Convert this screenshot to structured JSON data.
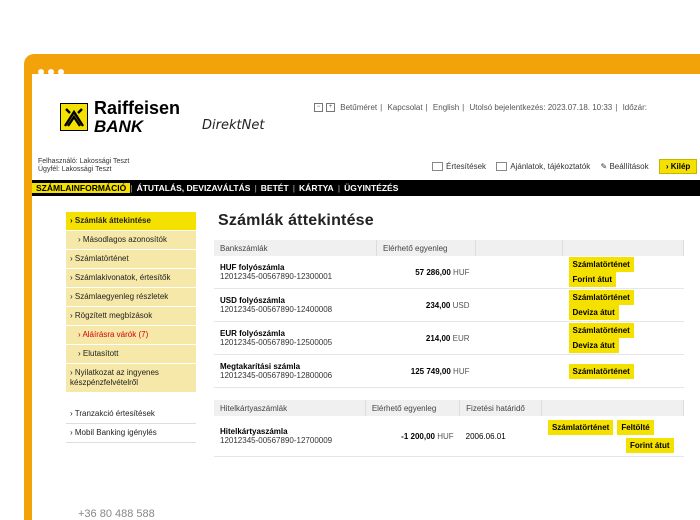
{
  "brand": {
    "name": "Raiffeisen",
    "sub": "BANK",
    "product": "DirektNet",
    "yellow": "#f5e100",
    "frame": "#f3a20a"
  },
  "toplinks": [
    "Betűméret",
    "Kapcsolat",
    "English",
    "Utolsó bejelentkezés: 2023.07.18. 10:33",
    "Időzár:"
  ],
  "user": {
    "line1": "Felhasználó: Lakossági Teszt",
    "line2": "Ügyfél: Lakossági Teszt"
  },
  "util": {
    "notifications": "Értesítések",
    "offers": "Ajánlatok, tájékoztatók",
    "settings": "Beállítások",
    "logout": "› Kilép"
  },
  "menu": [
    "SZÁMLAINFORMÁCIÓ",
    "ÁTUTALÁS, DEVIZAVÁLTÁS",
    "BETÉT",
    "KÁRTYA",
    "ÜGYINTÉZÉS"
  ],
  "sidebar": [
    "› Számlák áttekintése",
    "› Másodlagos azonosítók",
    "› Számlatörténet",
    "› Számlakivonatok, értesítők",
    "› Számlaegyenleg részletek",
    "› Rögzített megbízások",
    "› Aláírásra várók (7)",
    "› Elutasított",
    "› Nyilatkozat az ingyenes készpénzfelvételről",
    "› Tranzakció értesítések",
    "› Mobil Banking igénylés"
  ],
  "phone": "+36 80 488 588",
  "main": {
    "title": "Számlák áttekintése",
    "bank_headers": [
      "Bankszámlák",
      "Elérhető egyenleg",
      ""
    ],
    "accounts": [
      {
        "name": "HUF folyószámla",
        "number": "12012345-00567890-12300001",
        "amount": "57 286,00",
        "currency": "HUF",
        "b1": "Számlatörténet",
        "b2": "Forint átut"
      },
      {
        "name": "USD folyószámla",
        "number": "12012345-00567890-12400008",
        "amount": "234,00",
        "currency": "USD",
        "b1": "Számlatörténet",
        "b2": "Deviza átut"
      },
      {
        "name": "EUR folyószámla",
        "number": "12012345-00567890-12500005",
        "amount": "214,00",
        "currency": "EUR",
        "b1": "Számlatörténet",
        "b2": "Deviza átut"
      },
      {
        "name": "Megtakarítási számla",
        "number": "12012345-00567890-12800006",
        "amount": "125 749,00",
        "currency": "HUF",
        "b1": "Számlatörténet",
        "b2": ""
      }
    ],
    "card_headers": [
      "Hitelkártyaszámlák",
      "Elérhető egyenleg",
      "Fizetési határidő",
      ""
    ],
    "card": {
      "name": "Hitelkártyaszámla",
      "number": "12012345-00567890-12700009",
      "amount": "-1 200,00",
      "currency": "HUF",
      "due": "2006.06.01",
      "b1": "Számlatörténet",
      "b2": "Feltölté",
      "b3": "Forint átut"
    }
  }
}
